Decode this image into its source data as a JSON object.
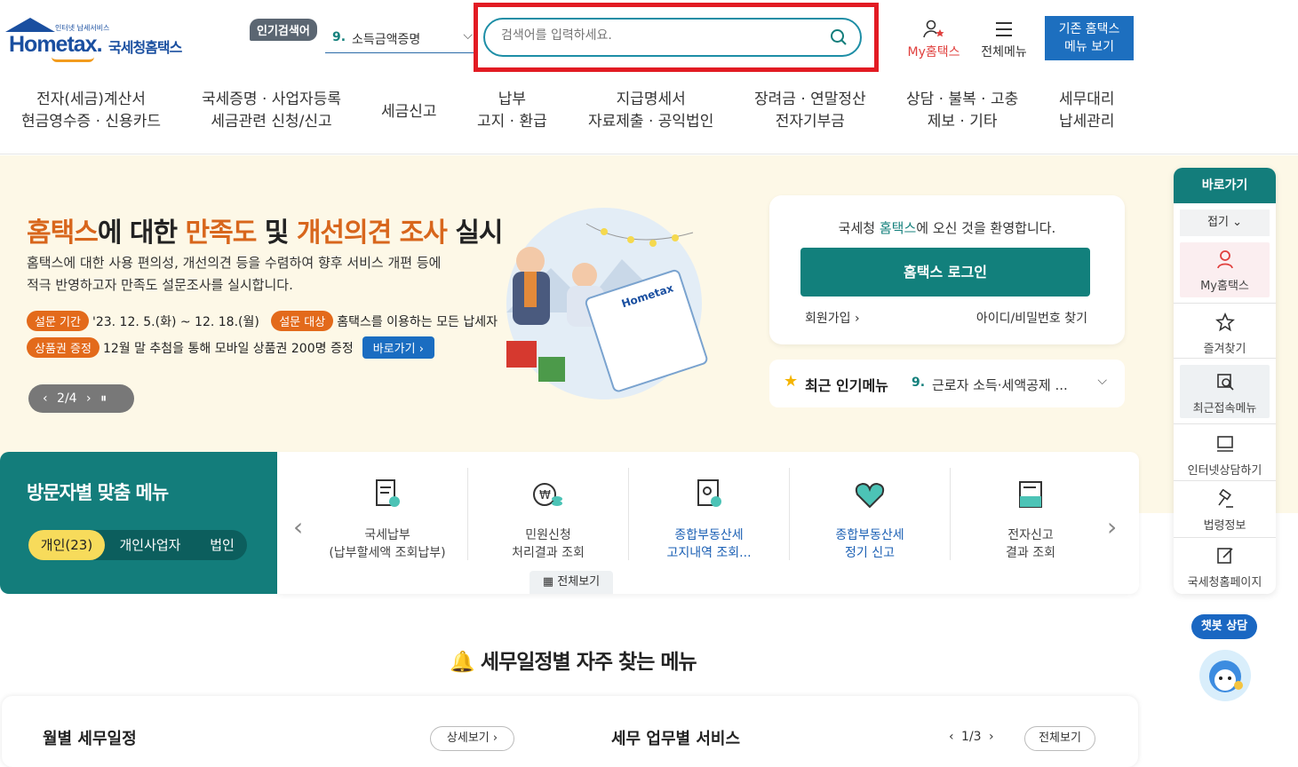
{
  "logo": {
    "small": "인터넷 납세서비스",
    "home": "Hometax.",
    "ko": "국세청홈택스"
  },
  "popular": {
    "badge": "인기검색어",
    "num": "9.",
    "text": "소득금액증명"
  },
  "search": {
    "placeholder": "검색어를 입력하세요."
  },
  "header": {
    "my": "My홈택스",
    "all": "전체메뉴",
    "old_line1": "기존 홈택스",
    "old_line2": "메뉴 보기"
  },
  "gnb": [
    {
      "l1": "전자(세금)계산서",
      "l2": "현금영수증 · 신용카드"
    },
    {
      "l1": "국세증명 · 사업자등록",
      "l2": "세금관련 신청/신고"
    },
    {
      "l1": "세금신고",
      "l2": ""
    },
    {
      "l1": "납부",
      "l2": "고지 · 환급"
    },
    {
      "l1": "지급명세서",
      "l2": "자료제출 · 공익법인"
    },
    {
      "l1": "장려금 · 연말정산",
      "l2": "전자기부금"
    },
    {
      "l1": "상담 · 불복 · 고충",
      "l2": "제보 · 기타"
    },
    {
      "l1": "세무대리",
      "l2": "납세관리"
    }
  ],
  "hero": {
    "t1": "홈택스",
    "t2": "에 대한 ",
    "t3": "만족도",
    "t4": " 및 ",
    "t5": "개선의견 조사",
    "t6": " 실시",
    "desc1": "홈택스에 대한 사용 편의성, 개선의견 등을 수렴하여 향후 서비스 개편 등에",
    "desc2": "적극 반영하고자 만족도 설문조사를 실시합니다.",
    "tag1": "설문 기간",
    "tag1_text": "'23. 12. 5.(화) ~ 12. 18.(월)",
    "tag2": "설문 대상",
    "tag2_text": "홈택스를 이용하는 모든 납세자",
    "tag3": "상품권 증정",
    "tag3_text": "12월 말 추첨을 통해 모바일 상품권 200명 증정",
    "goto": "바로가기 ›",
    "pager": "‹ 2/4 › ⏸"
  },
  "login": {
    "welcome_pre": "국세청 ",
    "welcome_hl": "홈택스",
    "welcome_post": "에 오신 것을 환영합니다.",
    "button": "홈택스 로그인",
    "join": "회원가입 ›",
    "find": "아이디/비밀번호 찾기"
  },
  "recent": {
    "label": "최근 인기메뉴",
    "num": "9.",
    "text": "근로자 소득·세액공제 ..."
  },
  "visitor": {
    "title": "방문자별 맞춤 메뉴",
    "tabs": [
      "개인(23)",
      "개인사업자",
      "법인"
    ]
  },
  "quick": [
    {
      "l1": "국세납부",
      "l2": "(납부할세액 조회납부)",
      "icon": "tax-pay-icon"
    },
    {
      "l1": "민원신청",
      "l2": "처리결과 조회",
      "icon": "civil-request-icon"
    },
    {
      "l1": "종합부동산세",
      "l2": "고지내역 조회...",
      "icon": "property-tax-notice-icon"
    },
    {
      "l1": "종합부동산세",
      "l2": "정기 신고",
      "icon": "property-tax-report-icon"
    },
    {
      "l1": "전자신고",
      "l2": "결과 조회",
      "icon": "e-filing-result-icon"
    }
  ],
  "allview": "전체보기",
  "side": {
    "head": "바로가기",
    "fold": "접기 ⌄",
    "items": [
      "My홈택스",
      "즐겨찾기",
      "최근접속메뉴",
      "인터넷상담하기",
      "법령정보",
      "국세청홈페이지"
    ]
  },
  "chatbot": "챗봇 상담",
  "schedule": {
    "title": "세무일정별 자주 찾는 메뉴",
    "monthly": "월별 세무일정",
    "detail": "상세보기 ›",
    "services": "세무 업무별 서비스",
    "page": "‹ 1/3 ›",
    "all": "전체보기"
  },
  "colors": {
    "teal": "#137d7b",
    "orange": "#d8661c",
    "blue": "#1a6dc1",
    "red_box": "#e21b23"
  }
}
